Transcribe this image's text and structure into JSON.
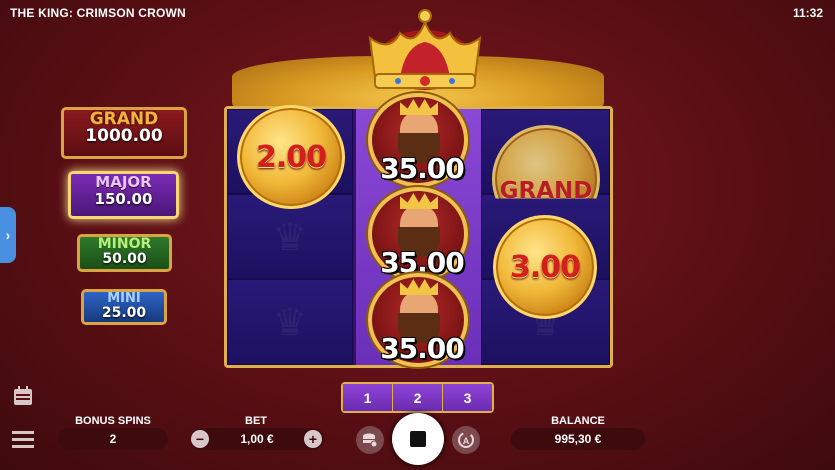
{
  "header": {
    "title": "THE KING: CRIMSON CROWN",
    "clock": "11:32"
  },
  "jackpots": [
    {
      "name": "GRAND",
      "value": "1000.00"
    },
    {
      "name": "MAJOR",
      "value": "150.00"
    },
    {
      "name": "MINOR",
      "value": "50.00"
    },
    {
      "name": "MINI",
      "value": "25.00"
    }
  ],
  "reels": {
    "coin_left_top": "2.00",
    "king_values": [
      "35.00",
      "35.00",
      "35.00"
    ],
    "grand_coin": "GRAND",
    "coin_right_mid": "3.00"
  },
  "reel_selector": [
    "1",
    "2",
    "3"
  ],
  "footer": {
    "bonus_spins_label": "BONUS SPINS",
    "bonus_spins_value": "2",
    "bet_label": "BET",
    "bet_value": "1,00 €",
    "balance_label": "BALANCE",
    "balance_value": "995,30 €"
  },
  "icons": [
    "calendar-icon",
    "menu-icon",
    "minus-icon",
    "plus-icon",
    "coin-stack-icon",
    "stop-icon",
    "autoplay-icon",
    "chevron-right-icon"
  ],
  "colors": {
    "accent_gold": "#e0b14b",
    "background": "#5a0f14",
    "reel_purple": "#7a33c4"
  }
}
